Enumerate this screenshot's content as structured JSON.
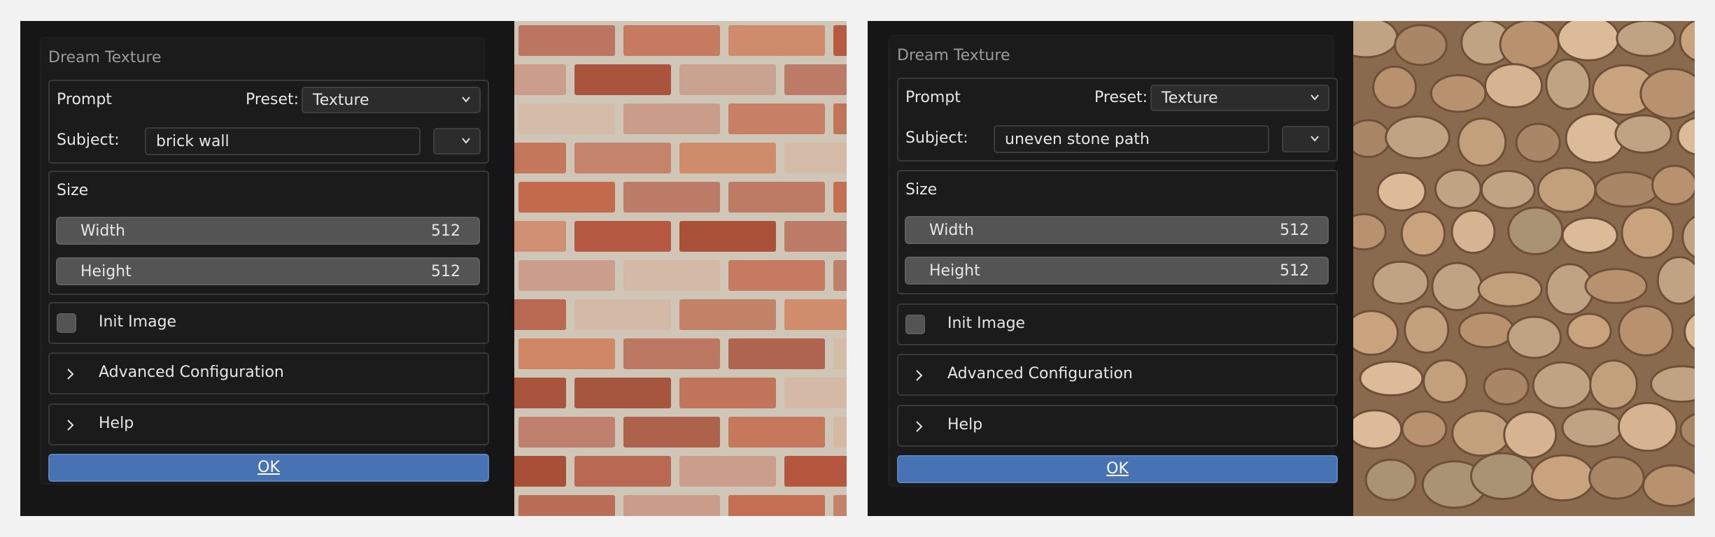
{
  "panels": [
    {
      "dialog_title": "Dream Texture",
      "prompt_label": "Prompt",
      "preset_label": "Preset:",
      "preset_value": "Texture",
      "subject_label": "Subject:",
      "subject_value": "brick wall",
      "size_label": "Size",
      "width_label": "Width",
      "width_value": "512",
      "height_label": "Height",
      "height_value": "512",
      "init_image_label": "Init Image",
      "advanced_label": "Advanced Configuration",
      "help_label": "Help",
      "ok_label": "OK",
      "preview_icon": "brick-wall-texture"
    },
    {
      "dialog_title": "Dream Texture",
      "prompt_label": "Prompt",
      "preset_label": "Preset:",
      "preset_value": "Texture",
      "subject_label": "Subject:",
      "subject_value": "uneven stone path",
      "size_label": "Size",
      "width_label": "Width",
      "width_value": "512",
      "height_label": "Height",
      "height_value": "512",
      "init_image_label": "Init Image",
      "advanced_label": "Advanced Configuration",
      "help_label": "Help",
      "ok_label": "OK",
      "preview_icon": "stone-path-texture"
    }
  ],
  "colors": {
    "background": "#f2f2f2",
    "panel": "#1b1b1b",
    "accent_button": "#4772b3",
    "slider": "#545454"
  }
}
